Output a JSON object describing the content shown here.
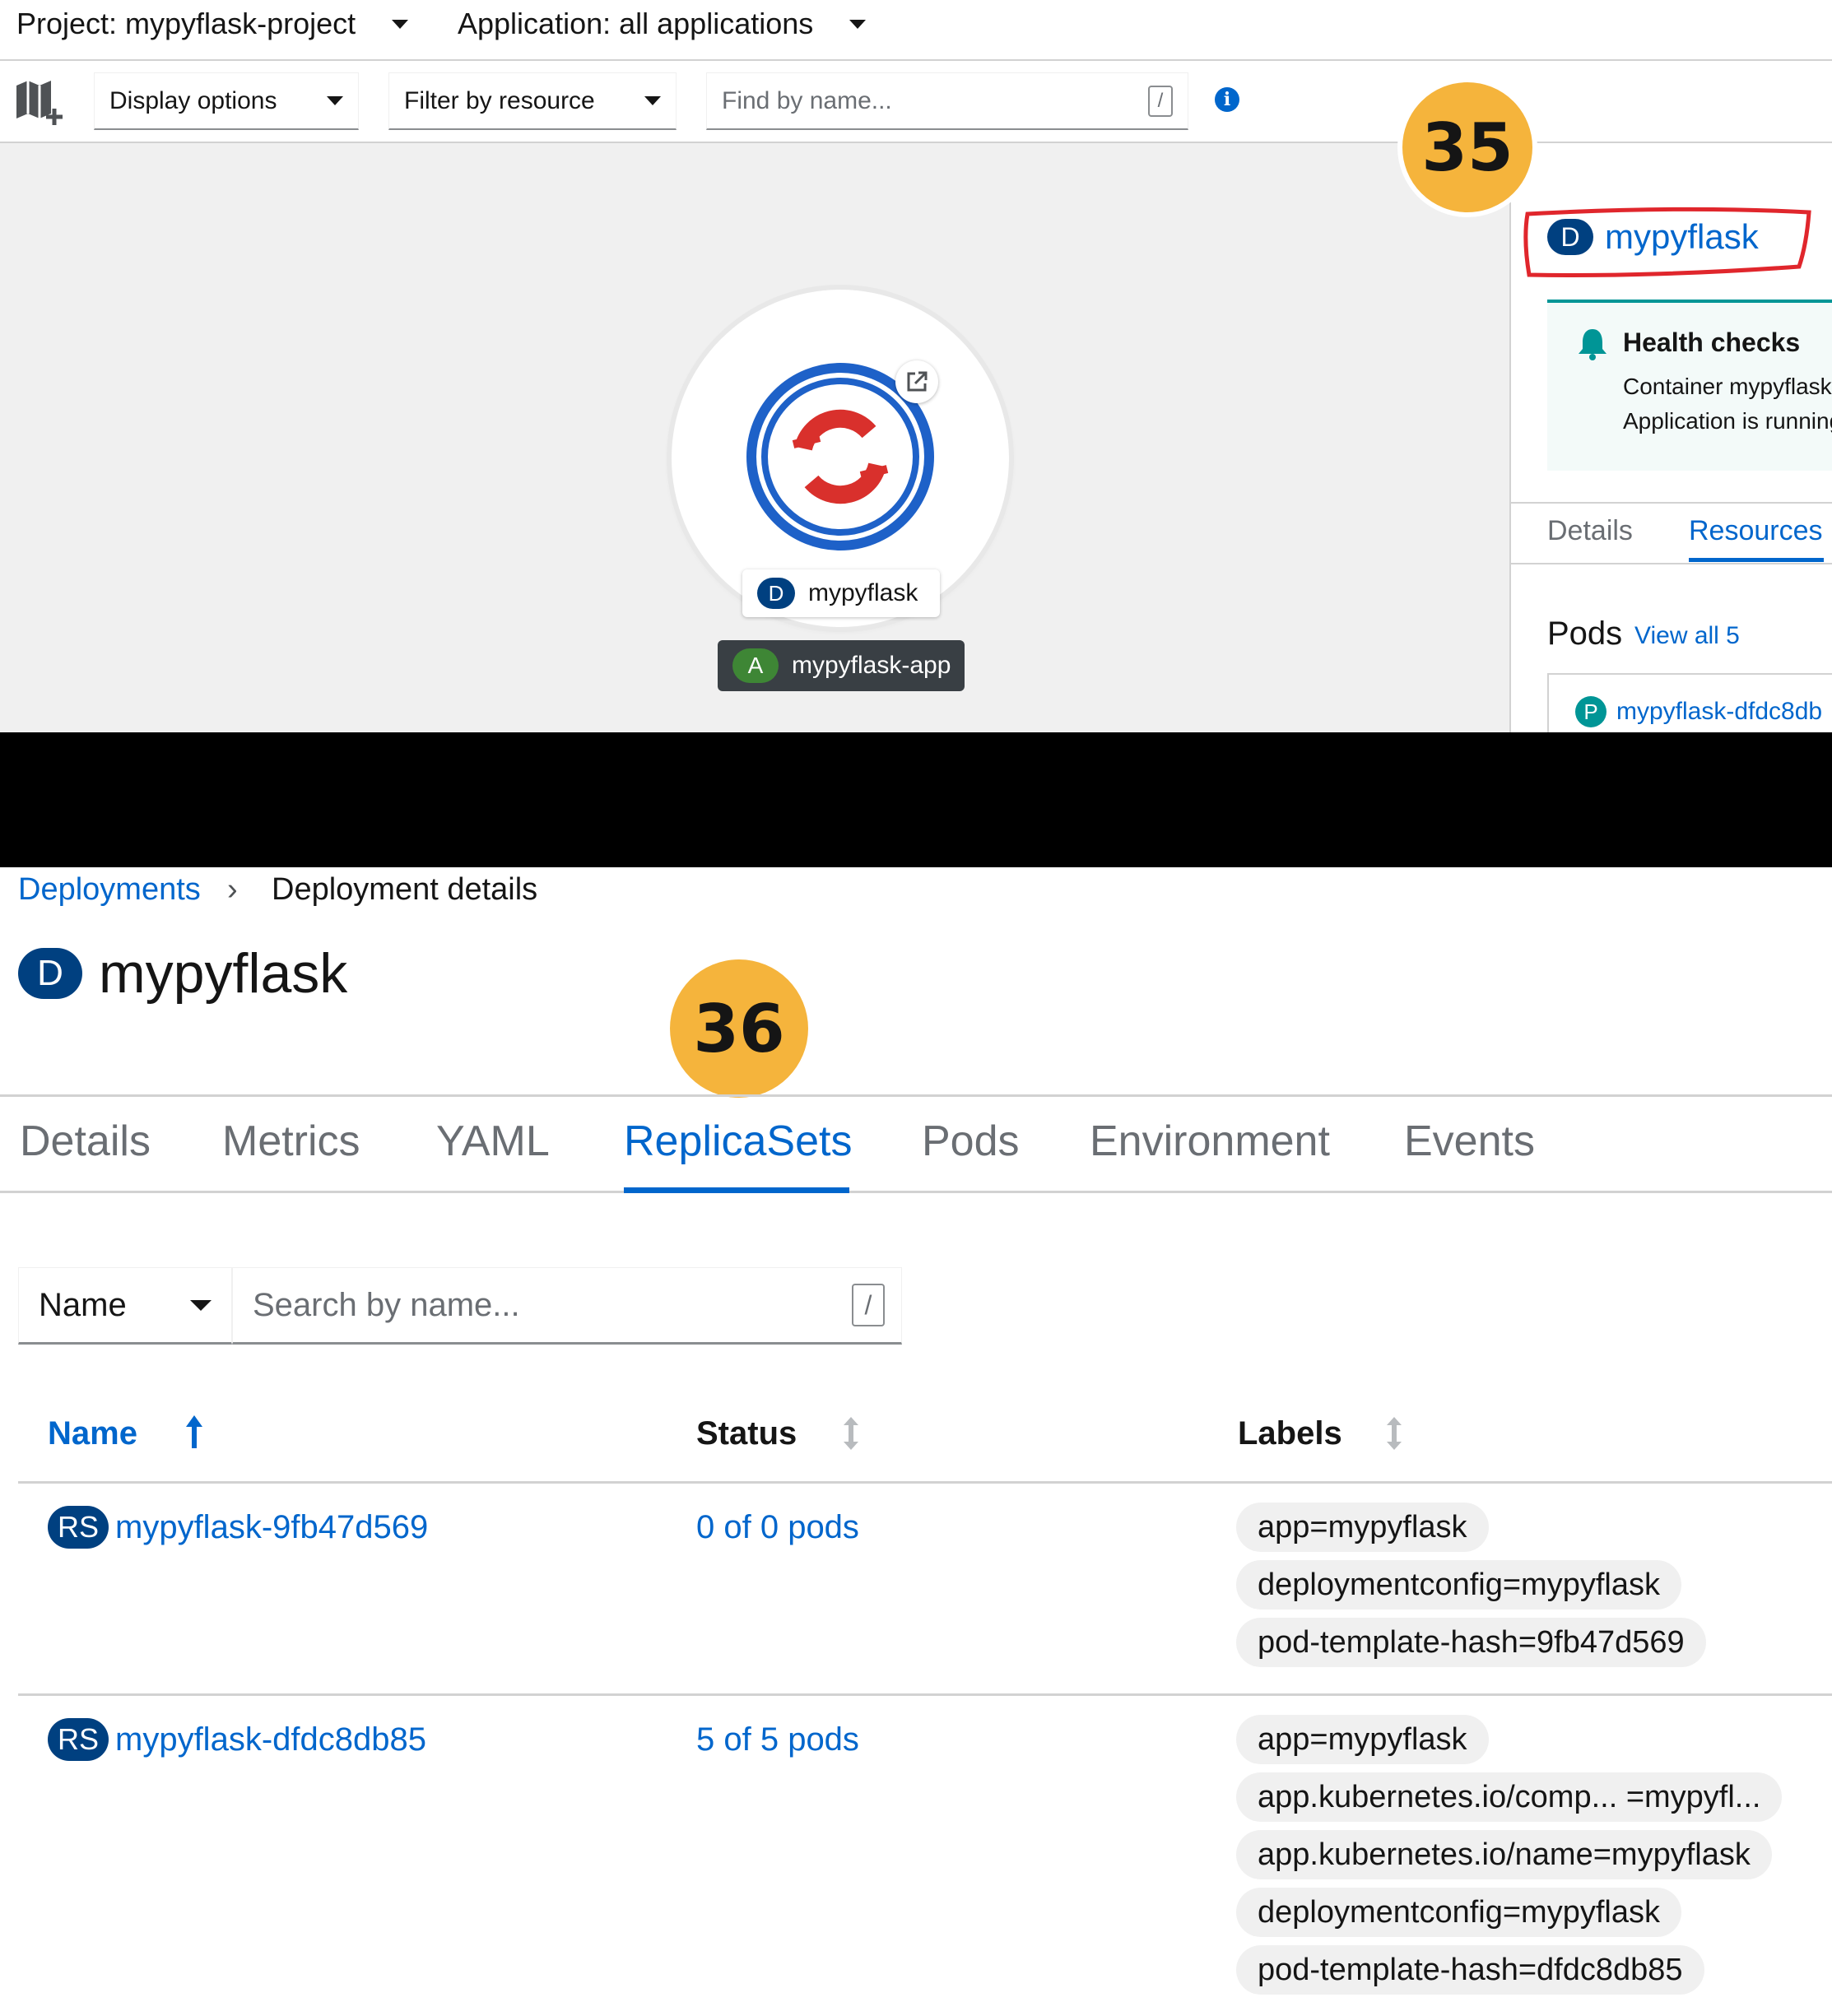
{
  "colors": {
    "accent": "#0066cc",
    "badge_dark_blue": "#004080",
    "step_badge": "#f5b43c",
    "highlight_circle": "#e0262c",
    "app_badge_green": "#3e8635"
  },
  "top": {
    "project_label": "Project: mypyflask-project",
    "application_label": "Application: all applications",
    "toolbar": {
      "display_options": "Display options",
      "filter_by_resource": "Filter by resource",
      "find_placeholder": "Find by name...",
      "slash_hint": "/"
    },
    "step_number": "35",
    "node": {
      "badge": "D",
      "name": "mypyflask",
      "app_badge": "A",
      "app_name": "mypyflask-app",
      "icon": "openshift-logo-icon"
    },
    "side_panel": {
      "badge": "D",
      "title": "mypyflask",
      "health_title": "Health checks",
      "health_line1": "Container mypyflask",
      "health_line2": "Application is running",
      "tab_details": "Details",
      "tab_resources": "Resources",
      "pods_title": "Pods",
      "view_all": "View all 5",
      "pod_badge": "P",
      "pod_name": "mypyflask-dfdc8db"
    }
  },
  "bottom": {
    "breadcrumb": {
      "link": "Deployments",
      "current": "Deployment details"
    },
    "title_badge": "D",
    "title": "mypyflask",
    "step_number": "36",
    "tabs": [
      "Details",
      "Metrics",
      "YAML",
      "ReplicaSets",
      "Pods",
      "Environment",
      "Events"
    ],
    "active_tab": "ReplicaSets",
    "filter": {
      "select_value": "Name",
      "search_placeholder": "Search by name...",
      "slash_hint": "/"
    },
    "table": {
      "headers": {
        "name": "Name",
        "status": "Status",
        "labels": "Labels"
      },
      "rows": [
        {
          "badge": "RS",
          "name": "mypyflask-9fb47d569",
          "status": "0 of 0 pods",
          "labels": [
            "app=mypyflask",
            "deploymentconfig=mypyflask",
            "pod-template-hash=9fb47d569"
          ]
        },
        {
          "badge": "RS",
          "name": "mypyflask-dfdc8db85",
          "status": "5 of 5 pods",
          "labels": [
            "app=mypyflask",
            "app.kubernetes.io/comp...  =mypyfl...",
            "app.kubernetes.io/name=mypyflask",
            "deploymentconfig=mypyflask",
            "pod-template-hash=dfdc8db85"
          ]
        }
      ]
    }
  }
}
